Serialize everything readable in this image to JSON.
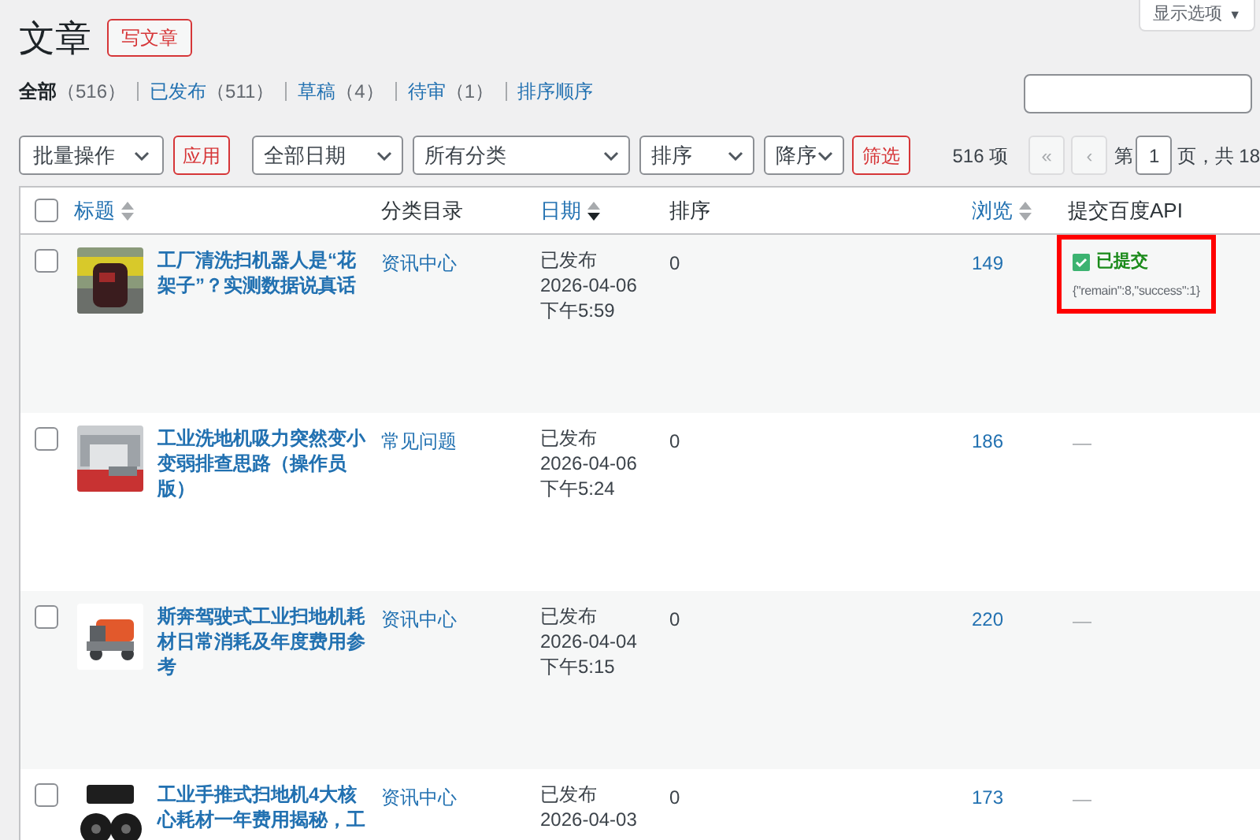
{
  "page_title": "文章",
  "add_new_button": "写文章",
  "screen_options_button": "显示选项",
  "screen_options_caret": "▼",
  "status_links": [
    {
      "label": "全部",
      "count": "（516）",
      "selected": true
    },
    {
      "label": "已发布",
      "count": "（511）",
      "selected": false
    },
    {
      "label": "草稿",
      "count": "（4）",
      "selected": false
    },
    {
      "label": "待审",
      "count": "（1）",
      "selected": false
    },
    {
      "label": "排序顺序",
      "selected": false
    }
  ],
  "bulk_actions": {
    "value": "批量操作"
  },
  "apply_button": "应用",
  "filters": [
    {
      "value": "全部日期"
    },
    {
      "value": "所有分类"
    },
    {
      "value": "排序"
    },
    {
      "value": "降序"
    }
  ],
  "filter_button": "筛选",
  "pagination": {
    "items_count": "516 项",
    "first": "«",
    "prev": "‹",
    "page_label": "第",
    "current_page": "1",
    "total_text": "页，共 18"
  },
  "table": {
    "select_all": {
      "checked": false
    },
    "columns": [
      {
        "label": "标题",
        "sortable": true,
        "sorted": false
      },
      {
        "label": "分类目录",
        "sortable": false
      },
      {
        "label": "日期",
        "sortable": true,
        "sorted": true
      },
      {
        "label": "排序",
        "sortable": false
      },
      {
        "label": "浏览",
        "sortable": true,
        "sorted": false
      },
      {
        "label": "提交百度API",
        "sortable": false
      }
    ],
    "rows": [
      {
        "checked": false,
        "title": "工厂清洗扫机器人是“花架子”？实测数据说真话",
        "category": "资讯中心",
        "status": "已发布",
        "date": "2026-04-06",
        "time": "下午5:59",
        "order": "0",
        "views": "149",
        "api": {
          "kind": "submitted",
          "label": "已提交",
          "detail": "{\"remain\":8,\"success\":1}",
          "highlighted": true
        }
      },
      {
        "checked": false,
        "title": "工业洗地机吸力突然变小变弱排查思路（操作员版）",
        "category": "常见问题",
        "status": "已发布",
        "date": "2026-04-06",
        "time": "下午5:24",
        "order": "0",
        "views": "186",
        "api": {
          "kind": "none",
          "label": "—",
          "highlighted": false
        }
      },
      {
        "checked": false,
        "title": "斯奔驾驶式工业扫地机耗材日常消耗及年度费用参考",
        "category": "资讯中心",
        "status": "已发布",
        "date": "2026-04-04",
        "time": "下午5:15",
        "order": "0",
        "views": "220",
        "api": {
          "kind": "none",
          "label": "—",
          "highlighted": false
        }
      },
      {
        "checked": false,
        "title": "工业手推式扫地机4大核心耗材一年费用揭秘，工",
        "category": "资讯中心",
        "status": "已发布",
        "date": "2026-04-03",
        "order": "0",
        "views": "173",
        "api": {
          "kind": "none",
          "label": "—",
          "highlighted": false
        }
      }
    ]
  }
}
